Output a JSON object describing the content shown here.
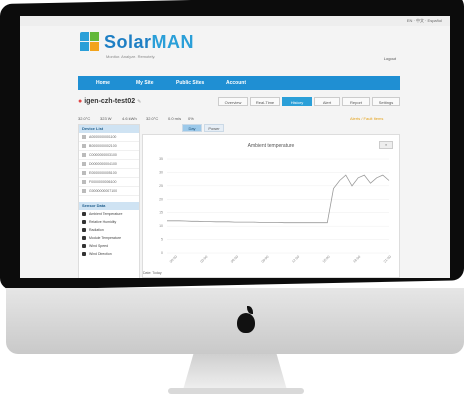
{
  "device": {
    "apple_logo": "apple-logo"
  },
  "top_links": "EN · 中文 · Español",
  "brand": {
    "part1": "Solar",
    "part2": "MAN",
    "tagline": "Monitor. Analyze. Remotely."
  },
  "logout": "Logout",
  "nav": [
    "Home",
    "My Site",
    "Public Sites",
    "Account"
  ],
  "station": {
    "name": "igen-czh-test02"
  },
  "tabs": [
    "Overview",
    "Real-Time",
    "History",
    "Alert",
    "Report",
    "Settings"
  ],
  "active_tab": "History",
  "stats": {
    "items": [
      "32.0°C",
      "323 W",
      "4.6 kWh",
      "32.0°C",
      "0.0 m/s",
      "0%"
    ],
    "alert": "Alerts / Fault Items"
  },
  "sidebar": {
    "device_list_title": "Device List",
    "devices": [
      "A0000000001100",
      "B0000000002100",
      "C0000000003100",
      "D0000000004100",
      "E0000000005100",
      "F0000000006100",
      "G0000000007100"
    ],
    "sensor_title": "Sensor Data",
    "sensors": [
      "Ambient Temperature",
      "Relative Humidity",
      "Radiation",
      "Module Temperature",
      "Wind Speed",
      "Wind Direction"
    ]
  },
  "subtabs": [
    "Day",
    "Power"
  ],
  "chart_menu": "≡",
  "chart_data": {
    "type": "line",
    "title": "Ambient temperature",
    "xlabel": "",
    "ylabel": "",
    "ylim": [
      0,
      35
    ],
    "yticks": [
      "35",
      "30",
      "25",
      "20",
      "15",
      "10",
      "5",
      "0"
    ],
    "x_ticks": [
      "00:00",
      "03:00",
      "06:00",
      "09:00",
      "12:00",
      "15:00",
      "18:00",
      "21:00"
    ],
    "series": [
      {
        "values": [
          12,
          12,
          12,
          11.9,
          11.8,
          11.8,
          11.7,
          11.7,
          11.6,
          11.6,
          11.6,
          11.5,
          11.5,
          11.5,
          11.5,
          11.4,
          11.4,
          11.4,
          11.4,
          11.3,
          11.3,
          11.3,
          11.3,
          11.3,
          11.3,
          11.3,
          11.3,
          24,
          27,
          29,
          25,
          28,
          29,
          26,
          28,
          29,
          27
        ]
      }
    ]
  },
  "chart_foot": "Date: Today"
}
